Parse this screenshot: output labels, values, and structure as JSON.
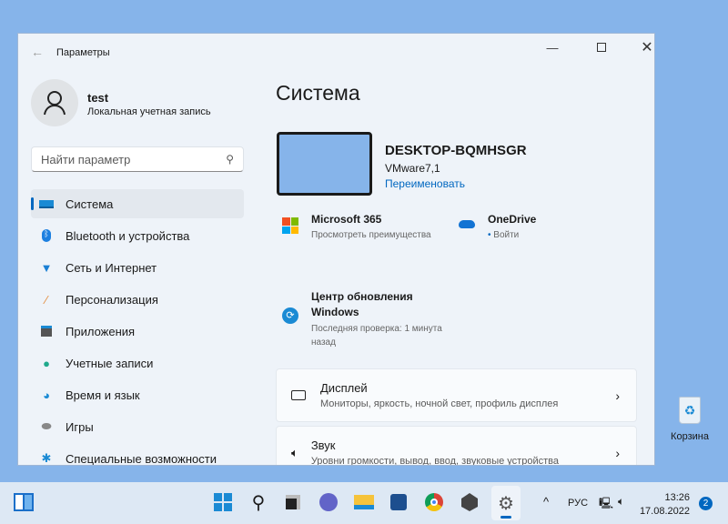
{
  "window": {
    "title": "Параметры"
  },
  "user": {
    "name": "test",
    "account_type": "Локальная учетная запись"
  },
  "search": {
    "placeholder": "Найти параметр"
  },
  "nav": [
    {
      "label": "Система",
      "icon": "monitor-icon"
    },
    {
      "label": "Bluetooth и устройства",
      "icon": "bluetooth-icon"
    },
    {
      "label": "Сеть и Интернет",
      "icon": "wifi-icon"
    },
    {
      "label": "Персонализация",
      "icon": "brush-icon"
    },
    {
      "label": "Приложения",
      "icon": "apps-icon"
    },
    {
      "label": "Учетные записи",
      "icon": "person-icon"
    },
    {
      "label": "Время и язык",
      "icon": "clock-globe-icon"
    },
    {
      "label": "Игры",
      "icon": "gamepad-icon"
    },
    {
      "label": "Специальные возможности",
      "icon": "accessibility-icon"
    }
  ],
  "main": {
    "title": "Система",
    "device_name": "DESKTOP-BQMHSGR",
    "device_model": "VMware7,1",
    "rename_link": "Переименовать",
    "ms365": {
      "title": "Microsoft 365",
      "subtitle": "Просмотреть преимущества"
    },
    "onedrive": {
      "title": "OneDrive",
      "subtitle": "Войти"
    },
    "update": {
      "title_line1": "Центр обновления",
      "title_line2": "Windows",
      "subtitle_line1": "Последняя проверка: 1 минута",
      "subtitle_line2": "назад"
    },
    "cards": [
      {
        "title": "Дисплей",
        "subtitle": "Мониторы, яркость, ночной свет, профиль дисплея"
      },
      {
        "title": "Звук",
        "subtitle": "Уровни громкости, вывод, ввод, звуковые устройства"
      }
    ]
  },
  "desktop": {
    "recycle_bin": "Корзина"
  },
  "taskbar": {
    "lang": "РУС",
    "time": "13:26",
    "date": "17.08.2022",
    "notifications": "2"
  },
  "colors": {
    "accent": "#0067c0",
    "desktop": "#86b4ea"
  }
}
